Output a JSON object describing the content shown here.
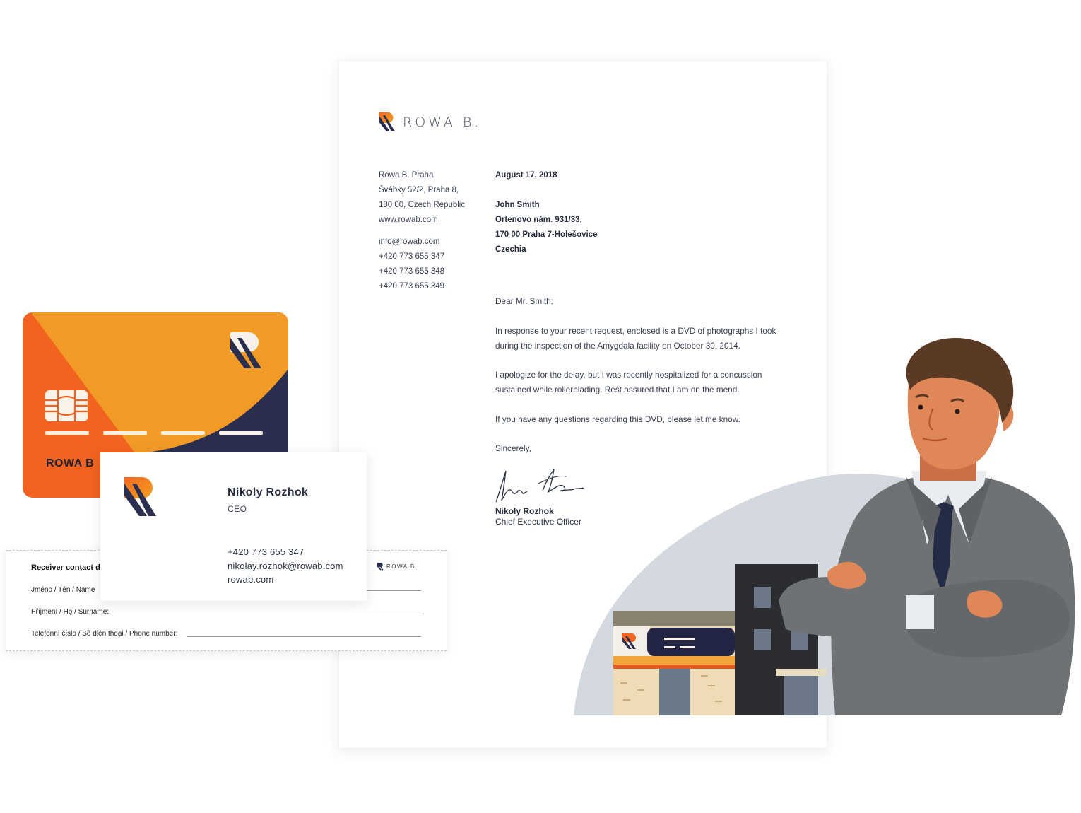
{
  "letterhead": {
    "brand": "ROWA B.",
    "sender_lines": [
      "Rowa B. Praha",
      "Švábky 52/2, Praha 8,",
      "180 00, Czech Republic",
      "www.rowab.com"
    ],
    "contact_lines": [
      "info@rowab.com",
      "+420 773 655 347",
      "+420 773 655 348",
      "+420 773 655 349"
    ],
    "date": "August 17, 2018",
    "recipient_lines": [
      "John Smith",
      "Ortenovo nám. 931/33,",
      "170 00 Praha 7-Holešovice",
      "Czechia"
    ],
    "salutation": "Dear Mr. Smith:",
    "paragraphs": [
      "In response to your recent request, enclosed is a DVD of photographs I took during the inspection of the Amygdala facility on October 30, 2014.",
      "I apologize for the delay, but I was recently hospitalized for a concussion sustained while rollerblading. Rest assured that I am on the mend.",
      "If you have any questions regarding this DVD, please let me know."
    ],
    "closing": "Sincerely,",
    "signer_name": "Nikoly Rozhok",
    "signer_title": "Chief Executive Officer"
  },
  "credit_card": {
    "label": "ROWA B"
  },
  "business_card": {
    "name": "Nikoly Rozhok",
    "title": "CEO",
    "phone": "+420 773 655 347",
    "email": "nikolay.rozhok@rowab.com",
    "website": "rowab.com"
  },
  "form_slip": {
    "title": "Receiver contact de",
    "brand": "ROWA B.",
    "field_name": "Jméno / Tên / Name",
    "field_surname": "Příjmení / Họ / Surname:",
    "field_phone": "Telefonní číslo / Số điện thoại / Phone number:"
  },
  "colors": {
    "orange": "#f26522",
    "amber": "#f29a26",
    "navy": "#2a2f4f",
    "suit": "#6e7275",
    "skin": "#e08757",
    "hair": "#5a3a24",
    "blob": "#d4d9df"
  },
  "icons": [
    "rowab-logo-icon",
    "chip-icon",
    "signature-icon"
  ]
}
